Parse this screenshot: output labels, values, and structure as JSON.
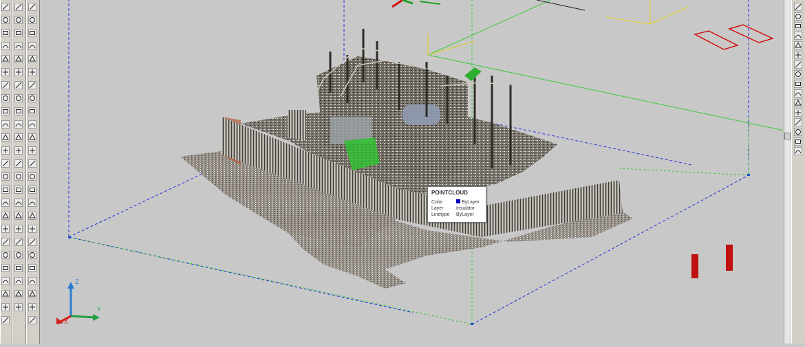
{
  "app": {
    "name": "CAD viewport"
  },
  "viewport": {
    "view": "3D isometric point cloud",
    "background_color": "#c8c8c8",
    "point_cloud": {
      "subject": "electrical substation"
    }
  },
  "tooltip": {
    "title": "POINTCLOUD",
    "rows": [
      {
        "label": "Color",
        "value": "ByLayer",
        "swatch_color": "#0000c0"
      },
      {
        "label": "Layer",
        "value": "Insulator"
      },
      {
        "label": "Linetype",
        "value": "ByLayer"
      }
    ]
  },
  "ucs": {
    "x_label": "X",
    "y_label": "Y",
    "z_label": "Z"
  },
  "colors": {
    "toolbar_bg": "#d4d0c8",
    "boundary_dashed": "#1f2fe0",
    "boundary_green": "#38c838",
    "highlight_yellow": "#e0d020",
    "marker_red": "#d01010"
  },
  "toolbars": {
    "left_draw_icons": [
      "line-icon",
      "construction-line-icon",
      "polyline-icon",
      "polygon-icon",
      "rectangle-icon",
      "arc-icon",
      "circle-icon",
      "revision-cloud-icon",
      "spline-icon",
      "ellipse-icon",
      "ellipse-arc-icon",
      "insert-block-icon",
      "make-block-icon",
      "point-icon",
      "hatch-icon",
      "gradient-icon",
      "region-icon",
      "table-icon",
      "multiline-text-icon"
    ],
    "left_modify_icons": [
      "erase-icon",
      "copy-icon",
      "mirror-icon",
      "offset-icon",
      "array-icon",
      "move-icon",
      "rotate-icon",
      "scale-icon",
      "stretch-icon",
      "trim-icon",
      "extend-icon",
      "break-icon",
      "join-icon",
      "chamfer-icon",
      "fillet-icon",
      "explode-icon"
    ],
    "right_icons": [
      "pan-icon",
      "zoom-icon",
      "orbit-icon",
      "walk-icon",
      "fly-icon",
      "camera-icon",
      "view-cube-icon",
      "steering-wheel-icon"
    ]
  }
}
